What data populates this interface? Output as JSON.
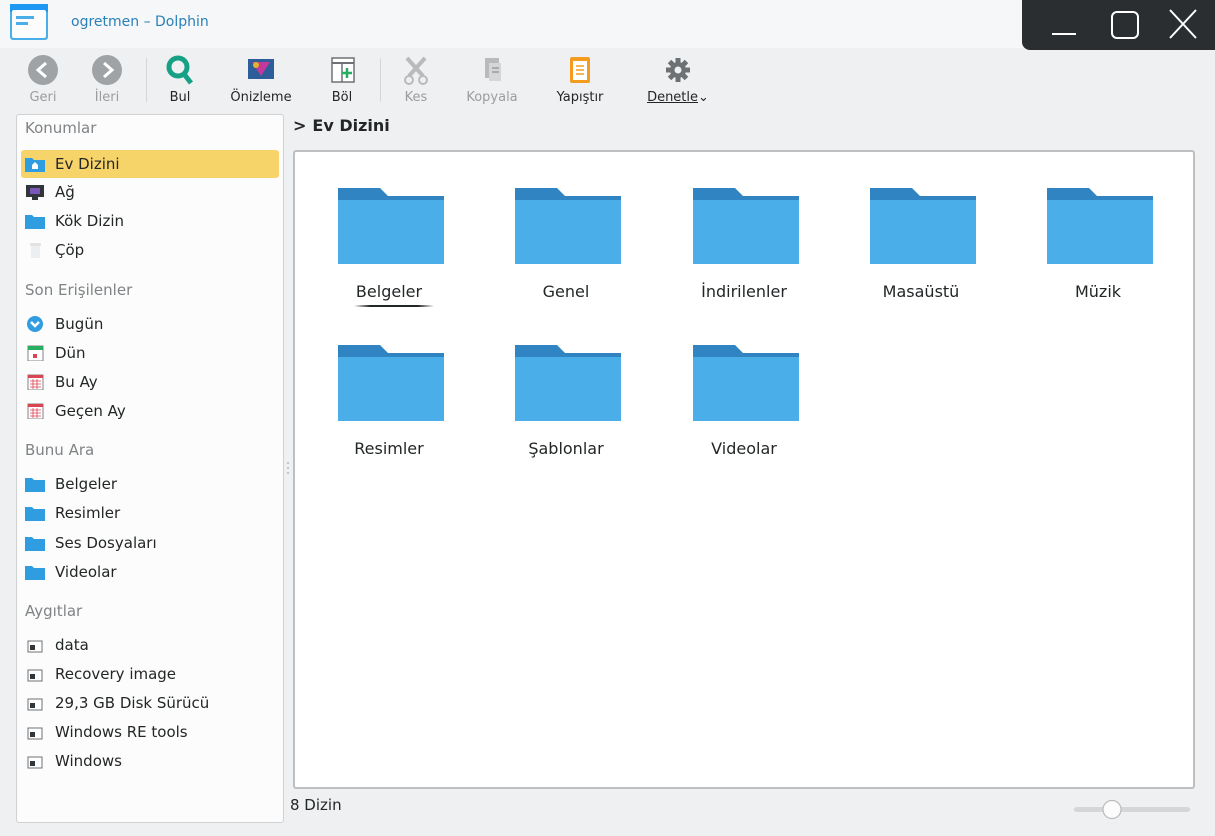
{
  "window": {
    "title": "ogretmen – Dolphin"
  },
  "toolbar": {
    "back": "Geri",
    "forward": "İleri",
    "find": "Bul",
    "preview": "Önizleme",
    "split": "Böl",
    "cut": "Kes",
    "copy": "Kopyala",
    "paste": "Yapıştır",
    "control": "Denetle"
  },
  "sidebar": {
    "places_title": "Konumlar",
    "places": [
      "Ev Dizini",
      "Ağ",
      "Kök Dizin",
      "Çöp"
    ],
    "recent_title": "Son Erişilenler",
    "recent": [
      "Bugün",
      "Dün",
      "Bu Ay",
      "Geçen Ay"
    ],
    "search_title": "Bunu Ara",
    "search": [
      "Belgeler",
      "Resimler",
      "Ses Dosyaları",
      "Videolar"
    ],
    "devices_title": "Aygıtlar",
    "devices": [
      "data",
      "Recovery image",
      "29,3 GB Disk Sürücü",
      "Windows RE tools",
      "Windows"
    ]
  },
  "location": {
    "current": "Ev Dizini"
  },
  "folders": [
    "Belgeler",
    "Genel",
    "İndirilenler",
    "Masaüstü",
    "Müzik",
    "Resimler",
    "Şablonlar",
    "Videolar"
  ],
  "status": {
    "summary": "8 Dizin"
  },
  "colors": {
    "accent": "#2980b9",
    "folder": "#4aaee8",
    "folder_tab": "#2f84c1",
    "selection": "#f7d46a"
  }
}
